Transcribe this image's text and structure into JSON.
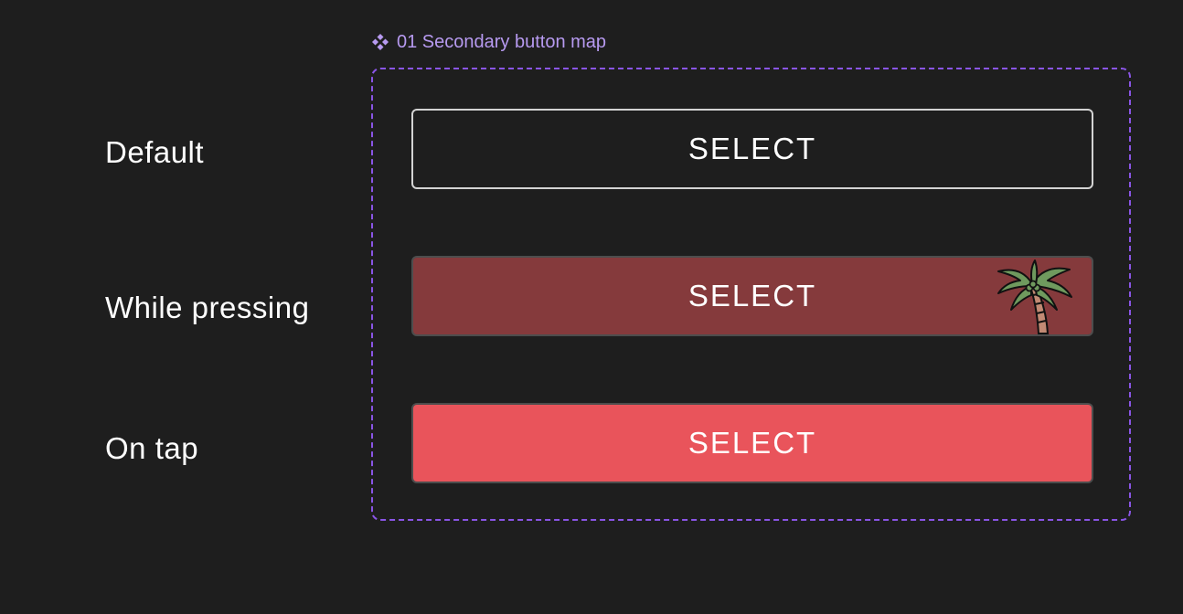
{
  "frame": {
    "title": "01 Secondary button map",
    "title_icon": "component-icon",
    "border_color": "#8a55e6",
    "title_color": "#b79af0"
  },
  "states": [
    {
      "label": "Default",
      "button_label": "SELECT",
      "button_bg": "transparent",
      "button_border": "#d3d3d3"
    },
    {
      "label": "While pressing",
      "button_label": "SELECT",
      "button_bg": "#853a3c",
      "decoration": "palm-tree-icon"
    },
    {
      "label": "On tap",
      "button_label": "SELECT",
      "button_bg": "#e9545b"
    }
  ],
  "colors": {
    "background": "#1e1e1e",
    "text": "#ffffff"
  }
}
